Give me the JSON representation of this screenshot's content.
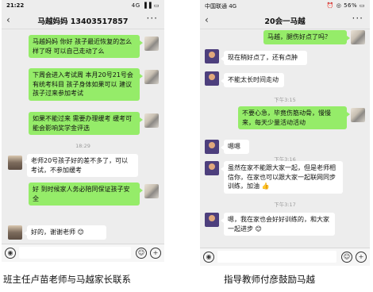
{
  "left": {
    "status_time": "21:22",
    "status_right": "4G ▐▐ ▭",
    "back": "‹",
    "title": "马越妈妈 13403517857",
    "more": "···",
    "messages": [
      "马越妈妈 你好 孩子最近恢复的怎么样了呀 可以自己走动了么",
      "下周会进入考试周 本月20号21号会有统考科目 孩子身体如果可以 建议孩子过来参加考试",
      "如果不能过来 需要办理缓考 缓考可能会影响奖学金评选",
      "老师20号孩子好的差不多了，可以考试，不参加缓考",
      "好 到时候家人务必陪同保证孩子安全",
      "好的，谢谢老师 😊"
    ],
    "time_divider": "18:29"
  },
  "right": {
    "status_time": "中国联通 4G",
    "status_right": "⏰ ◎ 56% ▭",
    "back": "‹",
    "title": "20会一马越",
    "more": "···",
    "messages": [
      "马越，腿伤好点了吗？",
      "现在稍好点了，还有点肿",
      "不能太长时间走动",
      "不要心急，毕竟伤筋动骨，慢慢来，每天少量活动活动",
      "嗯嗯",
      "虽然在家不能跟大家一起，但是老师相信你，在家也可以跟大家一起联网同步训练，加油 👍",
      "嗯，我在家也会好好训练的，和大家一起进步 😊"
    ],
    "time_divider_1": "下午3:15",
    "time_divider_2": "下午3:16",
    "time_divider_3": "下午3:17"
  },
  "captions": {
    "left": "班主任卢苗老师与马越家长联系",
    "right": "指导教师付彦鼓励马越"
  },
  "icons": [
    "voice-icon",
    "emoji-icon",
    "plus-icon",
    "back-icon",
    "more-icon"
  ]
}
